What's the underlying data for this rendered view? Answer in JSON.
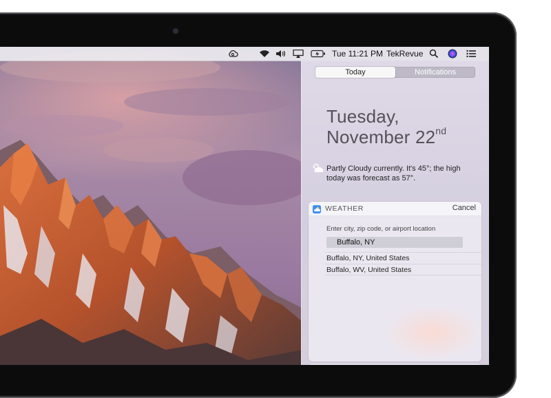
{
  "menubar": {
    "clock": "Tue 11:21 PM",
    "user": "TekRevue",
    "icons": [
      "creative-cloud-icon",
      "wifi-icon",
      "volume-icon",
      "airplay-icon",
      "battery-icon",
      "spotlight-icon",
      "siri-icon",
      "notification-center-icon"
    ]
  },
  "notification_center": {
    "tabs": [
      {
        "label": "Today",
        "active": true
      },
      {
        "label": "Notifications",
        "active": false
      }
    ],
    "date_line1": "Tuesday,",
    "date_line2": "November 22",
    "date_suffix": "nd",
    "weather_summary": "Partly Cloudy currently. It's 45°; the high today was forecast as 57°.",
    "weather_icon": "partly-cloudy-icon"
  },
  "weather_widget": {
    "title": "WEATHER",
    "cancel_label": "Cancel",
    "hint": "Enter city, zip code, or airport location",
    "input_value": "Buffalo, NY",
    "results": [
      "Buffalo, NY, United States",
      "Buffalo, WV, United States"
    ],
    "icon": "weather-app-icon"
  },
  "colors": {
    "bezel": "#0c0c0d",
    "sky_top": "#8d7d9b",
    "mountain_glow": "#e0733c"
  }
}
